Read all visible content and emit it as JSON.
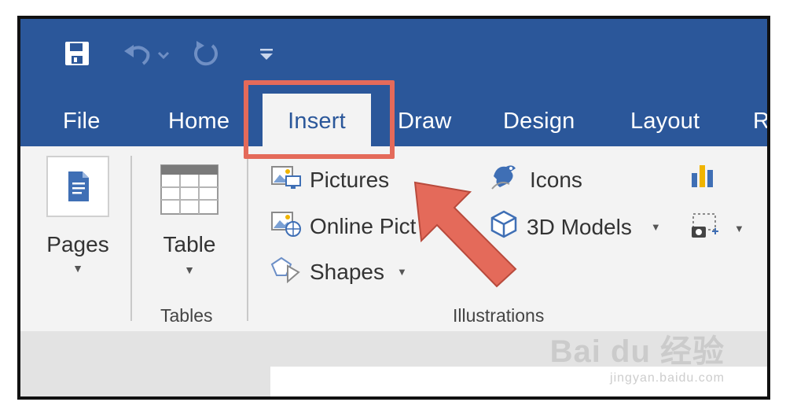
{
  "tabs": [
    "File",
    "Home",
    "Insert",
    "Draw",
    "Design",
    "Layout",
    "R"
  ],
  "active_tab": "Insert",
  "groups": {
    "pages": {
      "label": "Pages"
    },
    "tables": {
      "button": "Table",
      "label": "Tables"
    },
    "illustrations": {
      "label": "Illustrations",
      "pictures": "Pictures",
      "online_pictures": "Online Pict",
      "shapes": "Shapes",
      "icons": "Icons",
      "models": "3D Models"
    }
  },
  "colors": {
    "title_bar": "#2b579a",
    "ribbon": "#f3f3f3",
    "highlight": "#e46a5a"
  },
  "watermark": {
    "brand": "Bai du 经验",
    "url": "jingyan.baidu.com"
  }
}
